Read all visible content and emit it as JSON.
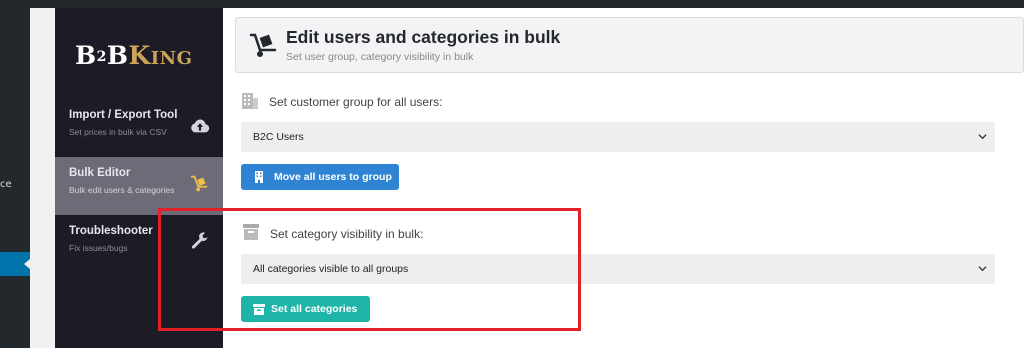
{
  "wp_sidebar": {
    "partial_text": "ce"
  },
  "logo": {
    "b": "B",
    "two": "2",
    "b2": "B",
    "king": "King"
  },
  "menu": [
    {
      "title": "Import / Export Tool",
      "subtitle": "Set prices in bulk via CSV",
      "icon": "cloud-upload-icon"
    },
    {
      "title": "Bulk Editor",
      "subtitle": "Bulk edit users & categories",
      "icon": "hand-truck-icon"
    },
    {
      "title": "Troubleshooter",
      "subtitle": "Fix issues/bugs",
      "icon": "wrench-icon"
    }
  ],
  "header": {
    "title": "Edit users and categories in bulk",
    "subtitle": "Set user group, category visibility in bulk",
    "icon": "hand-truck-icon"
  },
  "users_section": {
    "label": "Set customer group for all users:",
    "icon": "building-icon",
    "selected": "B2C Users",
    "button_label": "Move all users to group",
    "button_icon": "building-icon"
  },
  "categories_section": {
    "label": "Set category visibility in bulk:",
    "icon": "archive-icon",
    "selected": "All categories visible to all groups",
    "button_label": "Set all categories",
    "button_icon": "archive-icon"
  },
  "colors": {
    "wp_admin_dark": "#23282d",
    "wp_admin_active": "#0073aa",
    "sidebar_bg": "#1f1b26",
    "active_item": "#6f6a78",
    "logo_gold": "#c9a55a",
    "blue_button": "#2e84d3",
    "teal_button": "#1eb5a8",
    "highlight_red": "#e1222b"
  }
}
